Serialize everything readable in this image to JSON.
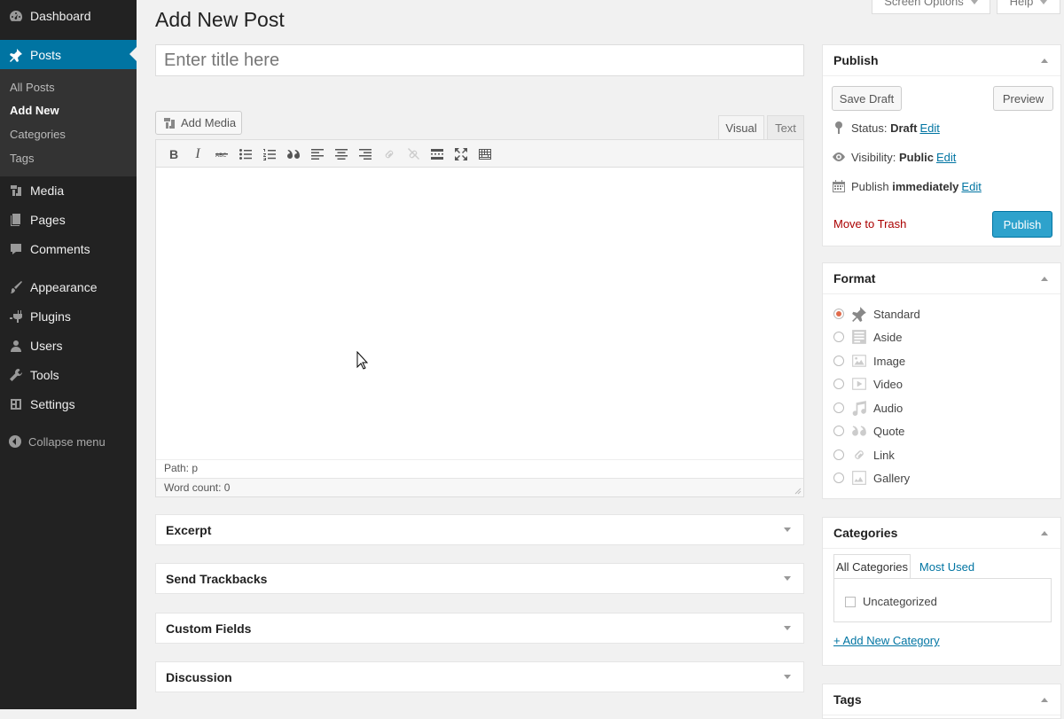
{
  "sidebar": {
    "items": [
      {
        "label": "Dashboard",
        "icon": "dashboard-icon"
      },
      {
        "label": "Posts",
        "icon": "pushpin-icon"
      },
      {
        "label": "Media",
        "icon": "media-icon"
      },
      {
        "label": "Pages",
        "icon": "pages-icon"
      },
      {
        "label": "Comments",
        "icon": "comments-icon"
      },
      {
        "label": "Appearance",
        "icon": "paintbrush-icon"
      },
      {
        "label": "Plugins",
        "icon": "plugin-icon"
      },
      {
        "label": "Users",
        "icon": "user-icon"
      },
      {
        "label": "Tools",
        "icon": "wrench-icon"
      },
      {
        "label": "Settings",
        "icon": "settings-icon"
      }
    ],
    "submenu": [
      "All Posts",
      "Add New",
      "Categories",
      "Tags"
    ],
    "collapse_label": "Collapse menu"
  },
  "header": {
    "screen_options": "Screen Options",
    "help": "Help",
    "page_title": "Add New Post"
  },
  "editor": {
    "title_placeholder": "Enter title here",
    "add_media": "Add Media",
    "tab_visual": "Visual",
    "tab_text": "Text",
    "path": "Path: p",
    "word_count": "Word count: 0"
  },
  "metaboxes": [
    "Excerpt",
    "Send Trackbacks",
    "Custom Fields",
    "Discussion"
  ],
  "publish": {
    "title": "Publish",
    "save_draft": "Save Draft",
    "preview": "Preview",
    "status_label": "Status:",
    "status_value": "Draft",
    "visibility_label": "Visibility:",
    "visibility_value": "Public",
    "schedule_label": "Publish",
    "schedule_value": "immediately",
    "edit": "Edit",
    "move_to_trash": "Move to Trash",
    "publish_button": "Publish"
  },
  "format": {
    "title": "Format",
    "selected": "Standard",
    "options": [
      "Standard",
      "Aside",
      "Image",
      "Video",
      "Audio",
      "Quote",
      "Link",
      "Gallery"
    ]
  },
  "categories": {
    "title": "Categories",
    "tab_all": "All Categories",
    "tab_most": "Most Used",
    "items": [
      "Uncategorized"
    ],
    "add_new": "+ Add New Category"
  },
  "tags": {
    "title": "Tags"
  },
  "colors": {
    "sidebar": "#222222",
    "active": "#0074a2",
    "publish_button": "#2ea2cc",
    "trash": "#aa0000"
  }
}
